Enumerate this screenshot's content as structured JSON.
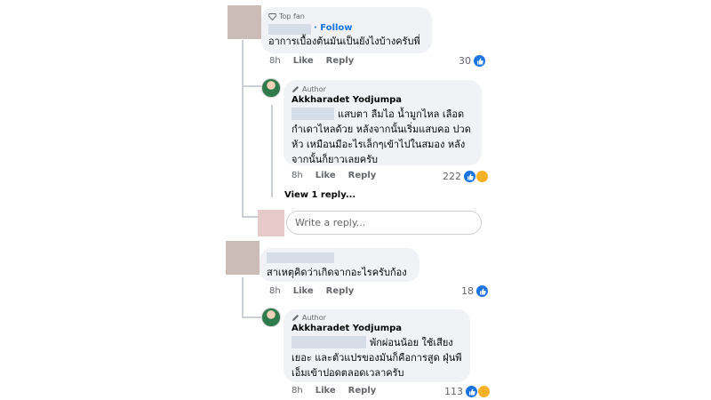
{
  "comment1": {
    "badge": "Top fan",
    "follow": "· Follow",
    "text": "อาการเบื้องต้นมันเป็นยังไงบ้างครับพี่",
    "time": "8h",
    "like": "Like",
    "reply": "Reply",
    "reaction_count": "30"
  },
  "reply1": {
    "badge": "Author",
    "name": "Akkharadet Yodjumpa",
    "line1": "แสบตา ลืมไอ น้ำมูกไหล เลือด",
    "line2": "กำเดาไหลด้วย หลังจากนั้นเริ่มแสบคอ ปวด",
    "line3": "หัว เหมือนมีอะไรเล็กๆเข้าไปในสมอง หลัง",
    "line4": "จากนั้นก็ยาวเลยครับ",
    "time": "8h",
    "like": "Like",
    "reply": "Reply",
    "reaction_count": "222"
  },
  "view_replies": "View 1 reply...",
  "reply_box": {
    "placeholder": "Write a reply..."
  },
  "comment2": {
    "text": "สาเหตุคิดว่าเกิดจากอะไรครับก้อง",
    "time": "8h",
    "like": "Like",
    "reply": "Reply",
    "reaction_count": "18"
  },
  "reply2": {
    "badge": "Author",
    "name": "Akkharadet Yodjumpa",
    "line1": "พักผ่อนน้อย ใช้เสียง",
    "line2": "เยอะ และตัวแปรของมันก็คือการสูด ฝุ่นพี",
    "line3": "เอ็มเข้าปอดตลอดเวลาครับ",
    "time": "8h",
    "like": "Like",
    "reply": "Reply",
    "reaction_count": "113"
  },
  "colors": {
    "accent": "#1b74e4",
    "bubble": "#f0f2f5",
    "secondary_text": "#65676b"
  }
}
